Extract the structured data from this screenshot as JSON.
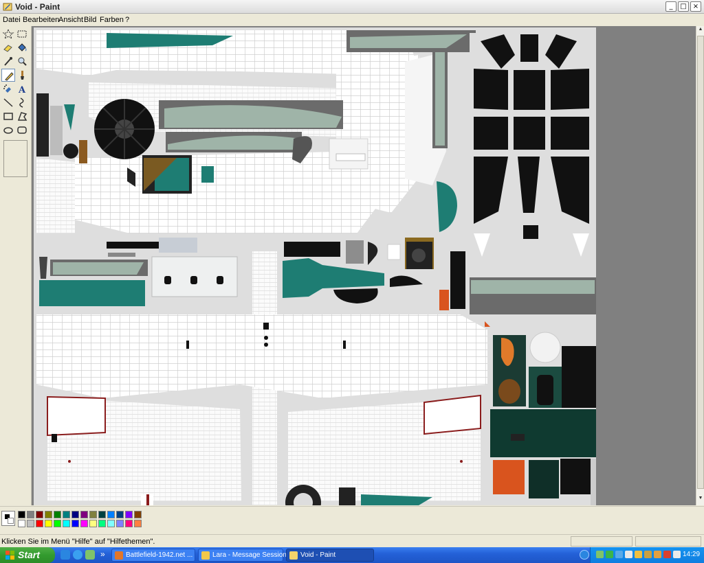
{
  "window": {
    "title": "Void - Paint",
    "controls": {
      "minimize": "_",
      "maximize": "□",
      "close": "×"
    }
  },
  "menu": [
    "Datei",
    "Bearbeiten",
    "Ansicht",
    "Bild",
    "Farben",
    "?"
  ],
  "tools": [
    {
      "name": "free-select-tool",
      "icon": "star-select-icon"
    },
    {
      "name": "rect-select-tool",
      "icon": "rect-select-icon"
    },
    {
      "name": "eraser-tool",
      "icon": "eraser-icon"
    },
    {
      "name": "fill-tool",
      "icon": "bucket-icon"
    },
    {
      "name": "color-picker-tool",
      "icon": "eyedropper-icon"
    },
    {
      "name": "magnifier-tool",
      "icon": "magnifier-icon"
    },
    {
      "name": "pencil-tool",
      "icon": "pencil-icon"
    },
    {
      "name": "brush-tool",
      "icon": "brush-icon"
    },
    {
      "name": "airbrush-tool",
      "icon": "airbrush-icon"
    },
    {
      "name": "text-tool",
      "icon": "text-icon",
      "glyph": "A"
    },
    {
      "name": "line-tool",
      "icon": "line-icon"
    },
    {
      "name": "curve-tool",
      "icon": "curve-icon"
    },
    {
      "name": "rectangle-tool",
      "icon": "rectangle-icon"
    },
    {
      "name": "polygon-tool",
      "icon": "polygon-icon"
    },
    {
      "name": "ellipse-tool",
      "icon": "ellipse-icon"
    },
    {
      "name": "rounded-rect-tool",
      "icon": "rounded-rect-icon"
    }
  ],
  "active_tool": "pencil-tool",
  "palette": {
    "foreground": "#000000",
    "background": "#ffffff",
    "colors_top": [
      "#000000",
      "#808080",
      "#800000",
      "#808000",
      "#008000",
      "#008080",
      "#000080",
      "#800080",
      "#808040",
      "#004040",
      "#0080ff",
      "#004080",
      "#8000ff",
      "#804000"
    ],
    "colors_bottom": [
      "#ffffff",
      "#c0c0c0",
      "#ff0000",
      "#ffff00",
      "#00ff00",
      "#00ffff",
      "#0000ff",
      "#ff00ff",
      "#ffff80",
      "#00ff80",
      "#80ffff",
      "#8080ff",
      "#ff0080",
      "#ff8040"
    ]
  },
  "status": {
    "text": "Klicken Sie im Menü \"Hilfe\" auf \"Hilfethemen\"."
  },
  "taskbar": {
    "start_label": "Start",
    "quick_launch_more": "»",
    "tasks": [
      {
        "label": "Battlefield-1942.net ...",
        "icon": "firefox-icon",
        "active": false
      },
      {
        "label": "Lara - Message Session",
        "icon": "messenger-icon",
        "active": false
      },
      {
        "label": "Void - Paint",
        "icon": "paint-icon",
        "active": true
      }
    ],
    "clock": "14:29"
  }
}
